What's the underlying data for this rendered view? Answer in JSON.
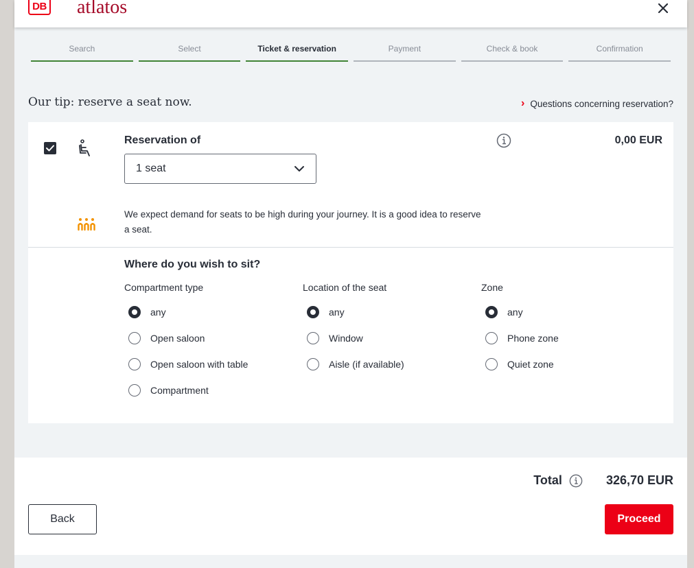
{
  "header": {
    "logo_text": "DB",
    "brand": "atlatos",
    "close_icon": "close-icon"
  },
  "steps": [
    {
      "label": "Search",
      "state": "done"
    },
    {
      "label": "Select",
      "state": "done"
    },
    {
      "label": "Ticket & reservation",
      "state": "active"
    },
    {
      "label": "Payment",
      "state": "pending"
    },
    {
      "label": "Check & book",
      "state": "pending"
    },
    {
      "label": "Confirmation",
      "state": "pending"
    }
  ],
  "tip": "Our tip: reserve a seat now.",
  "questions_link": "Questions concerning reservation?",
  "reservation": {
    "checked": true,
    "label": "Reservation of",
    "selected": "1 seat",
    "price": "0,00 EUR",
    "demand_text": "We expect demand for seats to be high during your journey. It is a good idea to reserve a seat."
  },
  "preferences": {
    "title": "Where do you wish to sit?",
    "compartment": {
      "title": "Compartment type",
      "options": [
        "any",
        "Open saloon",
        "Open saloon with table",
        "Compartment"
      ],
      "selected": 0
    },
    "location": {
      "title": "Location of the seat",
      "options": [
        "any",
        "Window",
        "Aisle (if available)"
      ],
      "selected": 0
    },
    "zone": {
      "title": "Zone",
      "options": [
        "any",
        "Phone zone",
        "Quiet zone"
      ],
      "selected": 0
    }
  },
  "footer": {
    "total_label": "Total",
    "total_amount": "326,70 EUR",
    "back": "Back",
    "proceed": "Proceed"
  },
  "colors": {
    "accent_red": "#ec0016",
    "brand_red": "#a50a28",
    "progress_green": "#408335",
    "demand_orange": "#f39200"
  }
}
